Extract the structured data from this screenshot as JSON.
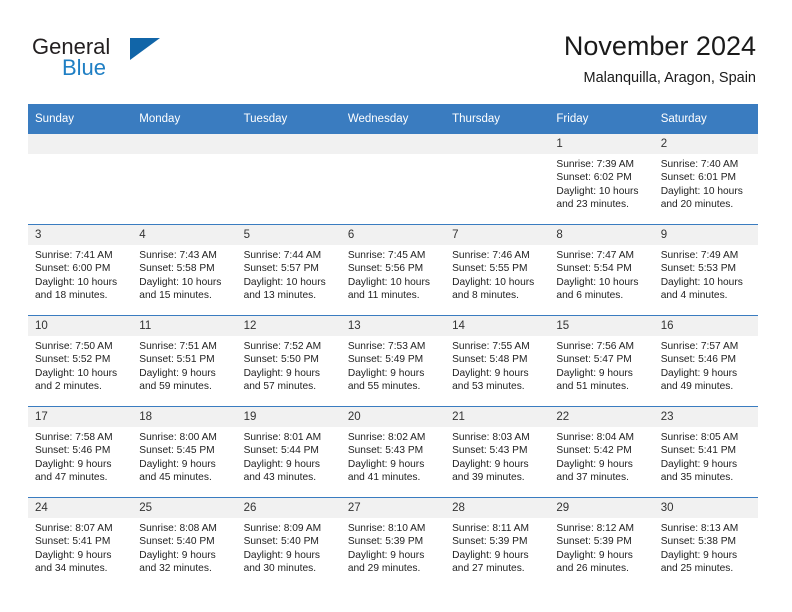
{
  "brand": {
    "word1": "General",
    "word2": "Blue",
    "triangle_color": "#1165a8",
    "blue_color": "#1f7fc4"
  },
  "header": {
    "title": "November 2024",
    "subtitle": "Malanquilla, Aragon, Spain"
  },
  "calendar": {
    "header_bg": "#3a7cc0",
    "daynum_bg": "#f1f1f1",
    "weekday_headers": [
      "Sunday",
      "Monday",
      "Tuesday",
      "Wednesday",
      "Thursday",
      "Friday",
      "Saturday"
    ],
    "weeks": [
      [
        {
          "day": "",
          "empty": true,
          "sunrise": "",
          "sunset": "",
          "daylight1": "",
          "daylight2": ""
        },
        {
          "day": "",
          "empty": true,
          "sunrise": "",
          "sunset": "",
          "daylight1": "",
          "daylight2": ""
        },
        {
          "day": "",
          "empty": true,
          "sunrise": "",
          "sunset": "",
          "daylight1": "",
          "daylight2": ""
        },
        {
          "day": "",
          "empty": true,
          "sunrise": "",
          "sunset": "",
          "daylight1": "",
          "daylight2": ""
        },
        {
          "day": "",
          "empty": true,
          "sunrise": "",
          "sunset": "",
          "daylight1": "",
          "daylight2": ""
        },
        {
          "day": "1",
          "empty": false,
          "sunrise": "Sunrise: 7:39 AM",
          "sunset": "Sunset: 6:02 PM",
          "daylight1": "Daylight: 10 hours",
          "daylight2": "and 23 minutes."
        },
        {
          "day": "2",
          "empty": false,
          "sunrise": "Sunrise: 7:40 AM",
          "sunset": "Sunset: 6:01 PM",
          "daylight1": "Daylight: 10 hours",
          "daylight2": "and 20 minutes."
        }
      ],
      [
        {
          "day": "3",
          "empty": false,
          "sunrise": "Sunrise: 7:41 AM",
          "sunset": "Sunset: 6:00 PM",
          "daylight1": "Daylight: 10 hours",
          "daylight2": "and 18 minutes."
        },
        {
          "day": "4",
          "empty": false,
          "sunrise": "Sunrise: 7:43 AM",
          "sunset": "Sunset: 5:58 PM",
          "daylight1": "Daylight: 10 hours",
          "daylight2": "and 15 minutes."
        },
        {
          "day": "5",
          "empty": false,
          "sunrise": "Sunrise: 7:44 AM",
          "sunset": "Sunset: 5:57 PM",
          "daylight1": "Daylight: 10 hours",
          "daylight2": "and 13 minutes."
        },
        {
          "day": "6",
          "empty": false,
          "sunrise": "Sunrise: 7:45 AM",
          "sunset": "Sunset: 5:56 PM",
          "daylight1": "Daylight: 10 hours",
          "daylight2": "and 11 minutes."
        },
        {
          "day": "7",
          "empty": false,
          "sunrise": "Sunrise: 7:46 AM",
          "sunset": "Sunset: 5:55 PM",
          "daylight1": "Daylight: 10 hours",
          "daylight2": "and 8 minutes."
        },
        {
          "day": "8",
          "empty": false,
          "sunrise": "Sunrise: 7:47 AM",
          "sunset": "Sunset: 5:54 PM",
          "daylight1": "Daylight: 10 hours",
          "daylight2": "and 6 minutes."
        },
        {
          "day": "9",
          "empty": false,
          "sunrise": "Sunrise: 7:49 AM",
          "sunset": "Sunset: 5:53 PM",
          "daylight1": "Daylight: 10 hours",
          "daylight2": "and 4 minutes."
        }
      ],
      [
        {
          "day": "10",
          "empty": false,
          "sunrise": "Sunrise: 7:50 AM",
          "sunset": "Sunset: 5:52 PM",
          "daylight1": "Daylight: 10 hours",
          "daylight2": "and 2 minutes."
        },
        {
          "day": "11",
          "empty": false,
          "sunrise": "Sunrise: 7:51 AM",
          "sunset": "Sunset: 5:51 PM",
          "daylight1": "Daylight: 9 hours",
          "daylight2": "and 59 minutes."
        },
        {
          "day": "12",
          "empty": false,
          "sunrise": "Sunrise: 7:52 AM",
          "sunset": "Sunset: 5:50 PM",
          "daylight1": "Daylight: 9 hours",
          "daylight2": "and 57 minutes."
        },
        {
          "day": "13",
          "empty": false,
          "sunrise": "Sunrise: 7:53 AM",
          "sunset": "Sunset: 5:49 PM",
          "daylight1": "Daylight: 9 hours",
          "daylight2": "and 55 minutes."
        },
        {
          "day": "14",
          "empty": false,
          "sunrise": "Sunrise: 7:55 AM",
          "sunset": "Sunset: 5:48 PM",
          "daylight1": "Daylight: 9 hours",
          "daylight2": "and 53 minutes."
        },
        {
          "day": "15",
          "empty": false,
          "sunrise": "Sunrise: 7:56 AM",
          "sunset": "Sunset: 5:47 PM",
          "daylight1": "Daylight: 9 hours",
          "daylight2": "and 51 minutes."
        },
        {
          "day": "16",
          "empty": false,
          "sunrise": "Sunrise: 7:57 AM",
          "sunset": "Sunset: 5:46 PM",
          "daylight1": "Daylight: 9 hours",
          "daylight2": "and 49 minutes."
        }
      ],
      [
        {
          "day": "17",
          "empty": false,
          "sunrise": "Sunrise: 7:58 AM",
          "sunset": "Sunset: 5:46 PM",
          "daylight1": "Daylight: 9 hours",
          "daylight2": "and 47 minutes."
        },
        {
          "day": "18",
          "empty": false,
          "sunrise": "Sunrise: 8:00 AM",
          "sunset": "Sunset: 5:45 PM",
          "daylight1": "Daylight: 9 hours",
          "daylight2": "and 45 minutes."
        },
        {
          "day": "19",
          "empty": false,
          "sunrise": "Sunrise: 8:01 AM",
          "sunset": "Sunset: 5:44 PM",
          "daylight1": "Daylight: 9 hours",
          "daylight2": "and 43 minutes."
        },
        {
          "day": "20",
          "empty": false,
          "sunrise": "Sunrise: 8:02 AM",
          "sunset": "Sunset: 5:43 PM",
          "daylight1": "Daylight: 9 hours",
          "daylight2": "and 41 minutes."
        },
        {
          "day": "21",
          "empty": false,
          "sunrise": "Sunrise: 8:03 AM",
          "sunset": "Sunset: 5:43 PM",
          "daylight1": "Daylight: 9 hours",
          "daylight2": "and 39 minutes."
        },
        {
          "day": "22",
          "empty": false,
          "sunrise": "Sunrise: 8:04 AM",
          "sunset": "Sunset: 5:42 PM",
          "daylight1": "Daylight: 9 hours",
          "daylight2": "and 37 minutes."
        },
        {
          "day": "23",
          "empty": false,
          "sunrise": "Sunrise: 8:05 AM",
          "sunset": "Sunset: 5:41 PM",
          "daylight1": "Daylight: 9 hours",
          "daylight2": "and 35 minutes."
        }
      ],
      [
        {
          "day": "24",
          "empty": false,
          "sunrise": "Sunrise: 8:07 AM",
          "sunset": "Sunset: 5:41 PM",
          "daylight1": "Daylight: 9 hours",
          "daylight2": "and 34 minutes."
        },
        {
          "day": "25",
          "empty": false,
          "sunrise": "Sunrise: 8:08 AM",
          "sunset": "Sunset: 5:40 PM",
          "daylight1": "Daylight: 9 hours",
          "daylight2": "and 32 minutes."
        },
        {
          "day": "26",
          "empty": false,
          "sunrise": "Sunrise: 8:09 AM",
          "sunset": "Sunset: 5:40 PM",
          "daylight1": "Daylight: 9 hours",
          "daylight2": "and 30 minutes."
        },
        {
          "day": "27",
          "empty": false,
          "sunrise": "Sunrise: 8:10 AM",
          "sunset": "Sunset: 5:39 PM",
          "daylight1": "Daylight: 9 hours",
          "daylight2": "and 29 minutes."
        },
        {
          "day": "28",
          "empty": false,
          "sunrise": "Sunrise: 8:11 AM",
          "sunset": "Sunset: 5:39 PM",
          "daylight1": "Daylight: 9 hours",
          "daylight2": "and 27 minutes."
        },
        {
          "day": "29",
          "empty": false,
          "sunrise": "Sunrise: 8:12 AM",
          "sunset": "Sunset: 5:39 PM",
          "daylight1": "Daylight: 9 hours",
          "daylight2": "and 26 minutes."
        },
        {
          "day": "30",
          "empty": false,
          "sunrise": "Sunrise: 8:13 AM",
          "sunset": "Sunset: 5:38 PM",
          "daylight1": "Daylight: 9 hours",
          "daylight2": "and 25 minutes."
        }
      ]
    ]
  }
}
